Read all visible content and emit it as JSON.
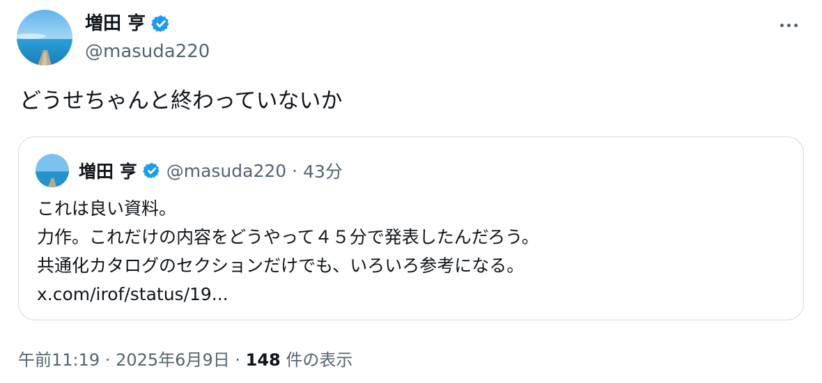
{
  "author": {
    "display_name": "増田 亨",
    "handle": "@masuda220",
    "verified_color": "#1d9bf0"
  },
  "menu": {
    "more_icon": "more-horizontal-icon"
  },
  "tweet": {
    "text": "どうせちゃんと終わっていないか"
  },
  "quote": {
    "display_name": "増田 亨",
    "handle": "@masuda220",
    "separator": "·",
    "time": "43分",
    "lines": [
      "これは良い資料。",
      "力作。これだけの内容をどうやって４５分で発表したんだろう。",
      "共通化カタログのセクションだけでも、いろいろ参考になる。",
      "x.com/irof/status/19..."
    ]
  },
  "meta": {
    "time": "午前11:19",
    "separator": "·",
    "date": "2025年6月9日",
    "views_count": "148",
    "views_label": "件の表示"
  }
}
